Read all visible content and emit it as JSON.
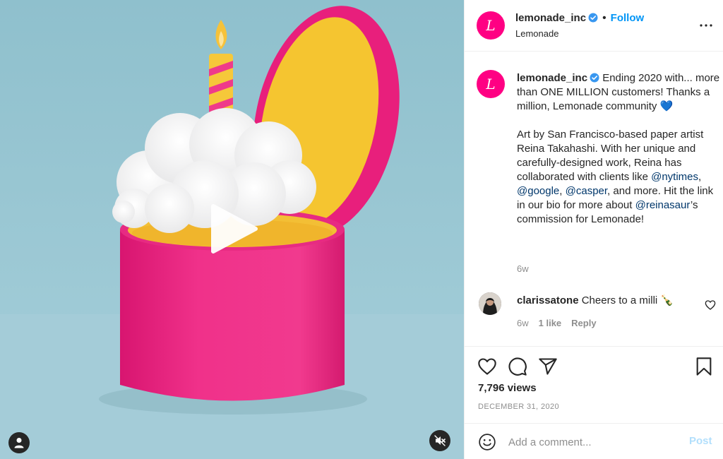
{
  "media": {
    "play_icon": "play-icon",
    "tag_icon": "user-tag-icon",
    "mute_icon": "muted-speaker-icon"
  },
  "header": {
    "avatar_letter": "L",
    "username": "lemonade_inc",
    "separator": "•",
    "follow_label": "Follow",
    "subtitle": "Lemonade",
    "more_icon": "more-options-icon"
  },
  "caption": {
    "avatar_letter": "L",
    "username": "lemonade_inc",
    "text1": " Ending 2020 with... more than ONE MILLION customers! Thanks a million, Lemonade community 💙",
    "p2_a": "Art by San Francisco-based paper artist Reina Takahashi. With her unique and carefully-designed work, Reina has collaborated with clients like ",
    "mention1": "@nytimes",
    "p2_b": ", ",
    "mention2": "@google",
    "p2_c": ", ",
    "mention3": "@casper",
    "p2_d": ", and more. Hit the link in our bio for more about ",
    "mention4": "@reinasaur",
    "p2_e": "’s commission for Lemonade!",
    "time": "6w"
  },
  "comment": {
    "username": "clarissatone",
    "text": " Cheers to a milli 🍾",
    "time": "6w",
    "likes": "1 like",
    "reply_label": "Reply"
  },
  "actions": {
    "like_icon": "heart-icon",
    "comment_icon": "comment-icon",
    "share_icon": "share-icon",
    "save_icon": "bookmark-icon",
    "views": "7,796 views",
    "date": "DECEMBER 31, 2020"
  },
  "add_comment": {
    "placeholder": "Add a comment...",
    "post_label": "Post",
    "emoji_icon": "emoji-icon"
  },
  "colors": {
    "brand_pink": "#ff0083",
    "link_blue": "#0095f6",
    "mention_blue": "#00376b",
    "muted_gray": "#8e8e8e"
  }
}
